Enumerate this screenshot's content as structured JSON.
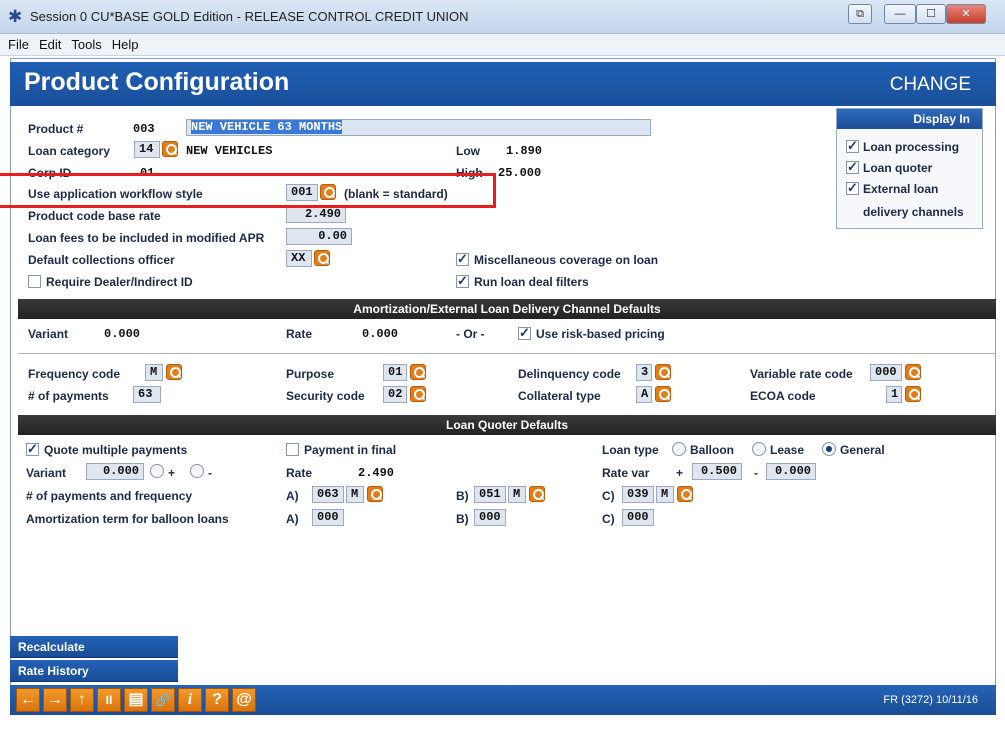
{
  "window": {
    "title": "Session 0 CU*BASE GOLD Edition - RELEASE CONTROL CREDIT UNION",
    "controls": [
      "⧉",
      "—",
      "☐",
      "✕"
    ]
  },
  "menu": [
    "File",
    "Edit",
    "Tools",
    "Help"
  ],
  "header": {
    "title": "Product Configuration",
    "mode": "CHANGE"
  },
  "product": {
    "product_label": "Product #",
    "product_num": "003",
    "product_desc": "NEW VEHICLE 63 MONTHS",
    "loan_cat_label": "Loan category",
    "loan_cat": "14",
    "loan_cat_desc": "NEW VEHICLES",
    "corp_label": "Corp ID",
    "corp": "01",
    "low_label": "Low",
    "low": "1.890",
    "high_label": "High",
    "high": "25.000",
    "workflow_label": "Use application workflow style",
    "workflow": "001",
    "workflow_hint": "(blank = standard)",
    "base_rate_label": "Product code base rate",
    "base_rate": "2.490",
    "apr_label": "Loan fees to be included in modified APR",
    "apr": "0.00",
    "officer_label": "Default collections officer",
    "officer": "XX",
    "dealer_label": "Require Dealer/Indirect ID",
    "misc_label": "Miscellaneous coverage on loan",
    "filters_label": "Run loan deal filters"
  },
  "display_in": {
    "header": "Display In",
    "loan_processing": "Loan processing",
    "loan_quoter": "Loan quoter",
    "external_1": "External loan",
    "external_2": "delivery channels"
  },
  "amort": {
    "section_title": "Amortization/External Loan Delivery Channel Defaults",
    "variant_label": "Variant",
    "variant": "0.000",
    "rate_label": "Rate",
    "rate": "0.000",
    "or_label": "- Or -",
    "risk_label": "Use risk-based pricing"
  },
  "codes": {
    "freq_label": "Frequency code",
    "freq": "M",
    "payments_label": "# of payments",
    "payments": "63",
    "purpose_label": "Purpose",
    "purpose": "01",
    "security_label": "Security code",
    "security": "02",
    "delinq_label": "Delinquency code",
    "delinq": "3",
    "collateral_label": "Collateral type",
    "collateral": "A",
    "varrate_label": "Variable rate code",
    "varrate": "000",
    "ecoa_label": "ECOA code",
    "ecoa": "1"
  },
  "quoter": {
    "section_title": "Loan Quoter Defaults",
    "multi_label": "Quote multiple payments",
    "final_label": "Payment in final",
    "loan_type_label": "Loan type",
    "balloon": "Balloon",
    "lease": "Lease",
    "general": "General",
    "variant_label": "Variant",
    "variant": "0.000",
    "plus": "+",
    "minus": "-",
    "rate_label": "Rate",
    "rate": "2.490",
    "ratevar_label": "Rate var",
    "ratevar_plus": "+",
    "ratevar_a": "0.500",
    "ratevar_minus": "-",
    "ratevar_b": "0.000",
    "pay_freq_label": "# of payments and frequency",
    "a_label": "A)",
    "b_label": "B)",
    "c_label": "C)",
    "pay_a": "063",
    "freq_a": "M",
    "pay_b": "051",
    "freq_b": "M",
    "pay_c": "039",
    "freq_c": "M",
    "balloon_term_label": "Amortization term for balloon loans",
    "bt_a": "000",
    "bt_b": "000",
    "bt_c": "000"
  },
  "side_buttons": [
    "Recalculate",
    "Rate History"
  ],
  "bottom": {
    "nav_glyphs": [
      "←",
      "→",
      "↑",
      "II",
      "▤",
      "🔗",
      "i",
      "?",
      "@"
    ],
    "status": "FR (3272) 10/11/16"
  },
  "colors": {
    "header_blue": "#1f5fb3",
    "lookup_orange": "#e27d18",
    "highlight_red": "#e81e1e"
  }
}
